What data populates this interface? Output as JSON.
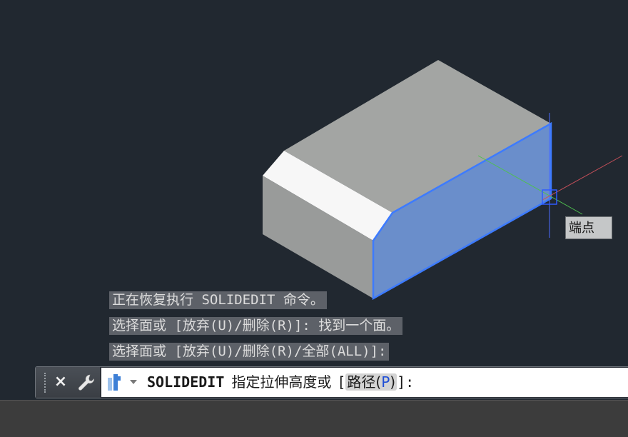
{
  "viewport": {
    "tooltip": "端点"
  },
  "history": [
    "正在恢复执行 SOLIDEDIT 命令。",
    "选择面或 [放弃(U)/删除(R)]: 找到一个面。",
    "选择面或 [放弃(U)/删除(R)/全部(ALL)]:"
  ],
  "command_line": {
    "close_icon": "×",
    "command_name": "SOLIDEDIT",
    "prompt": "指定拉伸高度或",
    "bracket_open": "[",
    "option_label": "路径(",
    "option_key": "P",
    "option_close": ")",
    "bracket_close": "]:"
  },
  "colors": {
    "background": "#212830",
    "selected_face": "#6a8ecb",
    "highlight_edge": "#3d7bff",
    "ucs_x_axis": "#c8505a",
    "ucs_y_axis": "#4fc04f",
    "ucs_z_axis": "#4a6cff"
  },
  "icons": [
    "close-icon",
    "wrench-icon",
    "command-icon",
    "dropdown-arrow-icon"
  ]
}
